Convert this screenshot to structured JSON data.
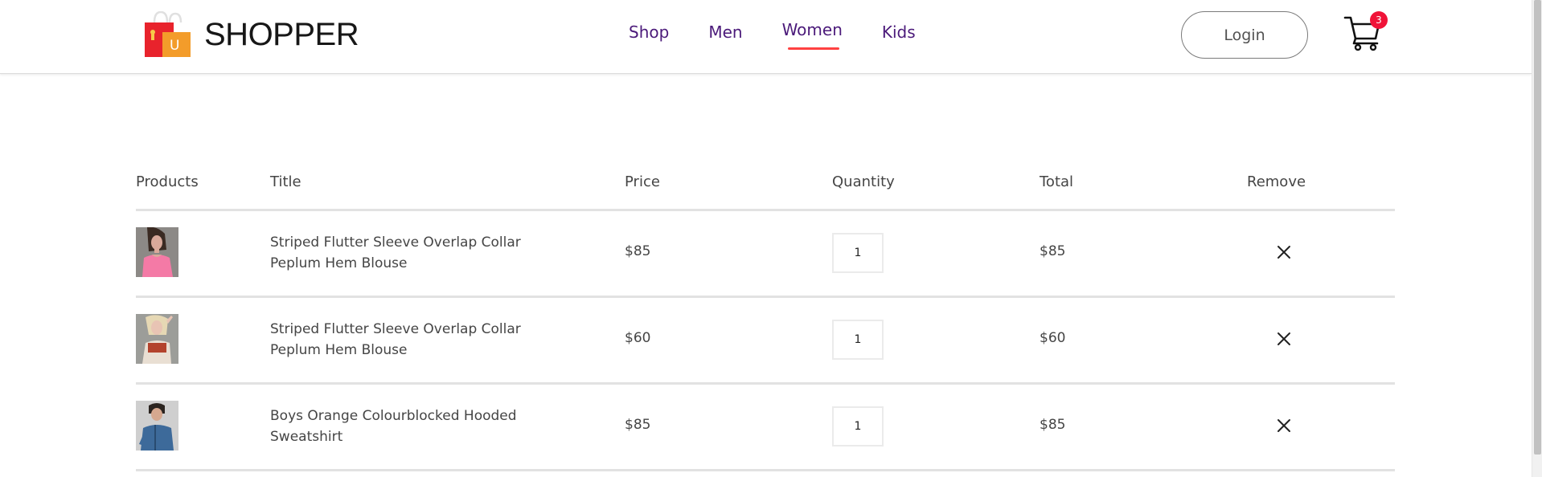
{
  "brand": {
    "name": "SHOPPER",
    "logo_letter": "U"
  },
  "nav": {
    "items": [
      {
        "label": "Shop",
        "active": false
      },
      {
        "label": "Men",
        "active": false
      },
      {
        "label": "Women",
        "active": true
      },
      {
        "label": "Kids",
        "active": false
      }
    ]
  },
  "header": {
    "login_label": "Login",
    "cart_count": "3"
  },
  "table": {
    "headers": {
      "products": "Products",
      "title": "Title",
      "price": "Price",
      "quantity": "Quantity",
      "total": "Total",
      "remove": "Remove"
    },
    "rows": [
      {
        "title": "Striped Flutter Sleeve Overlap Collar Peplum Hem Blouse",
        "price": "$85",
        "quantity": "1",
        "total": "$85"
      },
      {
        "title": "Striped Flutter Sleeve Overlap Collar Peplum Hem Blouse",
        "price": "$60",
        "quantity": "1",
        "total": "$60"
      },
      {
        "title": "Boys Orange Colourblocked Hooded Sweatshirt",
        "price": "$85",
        "quantity": "1",
        "total": "$85"
      }
    ]
  },
  "colors": {
    "accent": "#ff4141",
    "nav_text": "#4b1a7a",
    "badge": "#f01338"
  }
}
